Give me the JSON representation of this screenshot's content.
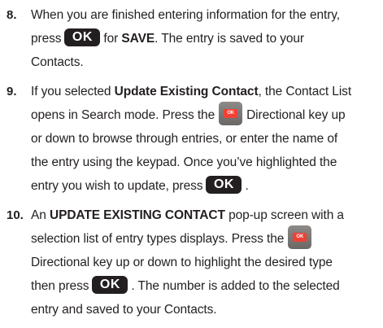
{
  "steps": [
    {
      "number": "8.",
      "lines": [
        [
          "When you are finished entering information for the entry,"
        ],
        [
          "press",
          "OK",
          "for",
          "SAVE",
          ". The entry is saved to your"
        ],
        [
          "Contacts."
        ]
      ]
    },
    {
      "number": "9.",
      "lines": [
        [
          "If you selected",
          "Update Existing Contact",
          ", the Contact List"
        ],
        [
          "opens in Search mode. Press the",
          "OK",
          "Directional key up"
        ],
        [
          "or down to browse through entries, or enter the name of"
        ],
        [
          "the entry using the keypad. Once you’ve highlighted the"
        ],
        [
          "entry you wish to update, press",
          "OK",
          "."
        ]
      ]
    },
    {
      "number": "10.",
      "lines": [
        [
          "An",
          "UPDATE EXISTING CONTACT",
          "pop-up screen with a"
        ],
        [
          "selection list of entry types displays. Press the",
          "OK"
        ],
        [
          "Directional key up or down to highlight the desired type"
        ],
        [
          "then press",
          "OK",
          ". The number is added to the selected"
        ],
        [
          "entry and saved to your Contacts."
        ]
      ]
    }
  ],
  "icons": {
    "ok_key": "ok-key-icon",
    "directional_key": "directional-key-icon"
  },
  "colors": {
    "text": "#231f20",
    "ok_key_bg": "#231f20",
    "ok_key_text": "#ffffff",
    "dir_key_bg": "#7a7674",
    "dir_key_center": "#ef4135"
  }
}
